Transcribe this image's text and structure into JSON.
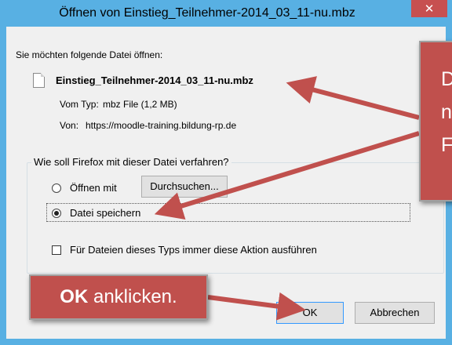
{
  "window": {
    "title": "Öffnen von Einstieg_Teilnehmer-2014_03_11-nu.mbz",
    "close_symbol": "✕"
  },
  "dialog": {
    "intro": "Sie möchten folgende Datei öffnen:",
    "file_icon": "file-icon",
    "filename": "Einstieg_Teilnehmer-2014_03_11-nu.mbz",
    "type_label": "Vom Typ:",
    "type_value": "mbz File (1,2 MB)",
    "from_label": "Von:",
    "from_value": "https://moodle-training.bildung-rp.de",
    "group_label": "Wie soll Firefox mit dieser Datei verfahren?",
    "open_with_label": "Öffnen mit",
    "browse_button": "Durchsuchen...",
    "save_file_label": "Datei speichern",
    "always_label": "Für Dateien dieses Typs immer diese Aktion ausführen",
    "ok_button": "OK",
    "cancel_button": "Abbrechen",
    "selected_option": "Datei speichern"
  },
  "annotations": {
    "right_callout_lines": [
      "D",
      "n",
      "F"
    ],
    "left_callout_bold": "OK",
    "left_callout_text": " anklicken.",
    "callout_color": "#c0504d"
  }
}
